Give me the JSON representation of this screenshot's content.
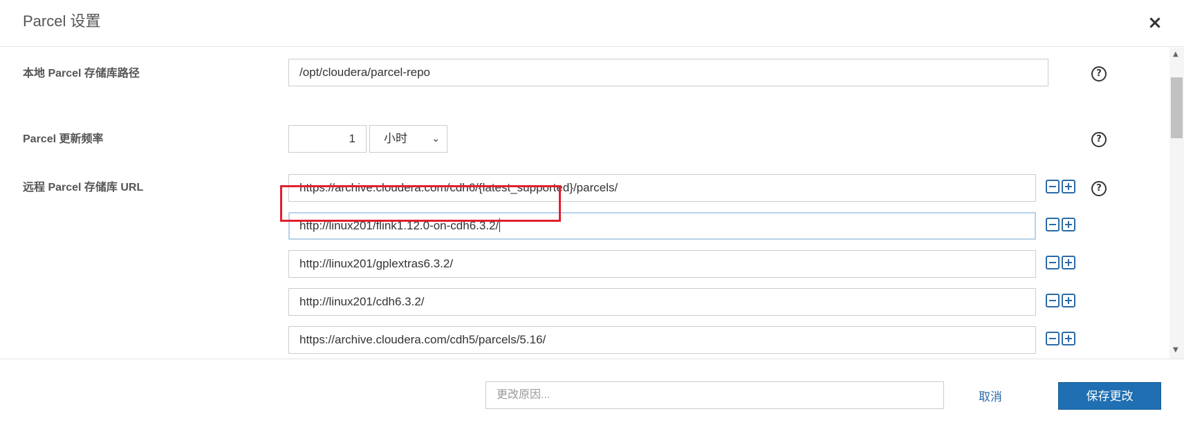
{
  "dialog": {
    "title": "Parcel 设置",
    "close_icon": "close-icon"
  },
  "settings": {
    "local_repo": {
      "label": "本地 Parcel 存储库路径",
      "value": "/opt/cloudera/parcel-repo"
    },
    "update_frequency": {
      "label": "Parcel 更新频率",
      "value": "1",
      "unit": "小时"
    },
    "remote_urls": {
      "label": "远程 Parcel 存储库 URL",
      "items": [
        "https://archive.cloudera.com/cdh6/{latest_supported}/parcels/",
        "http://linux201/flink1.12.0-on-cdh6.3.2/",
        "http://linux201/gplextras6.3.2/",
        "http://linux201/cdh6.3.2/",
        "https://archive.cloudera.com/cdh5/parcels/5.16/"
      ]
    }
  },
  "footer": {
    "reason_placeholder": "更改原因...",
    "cancel_label": "取消",
    "save_label": "保存更改"
  },
  "colors": {
    "accent": "#1f6fb2",
    "highlight": "#e0202e"
  }
}
